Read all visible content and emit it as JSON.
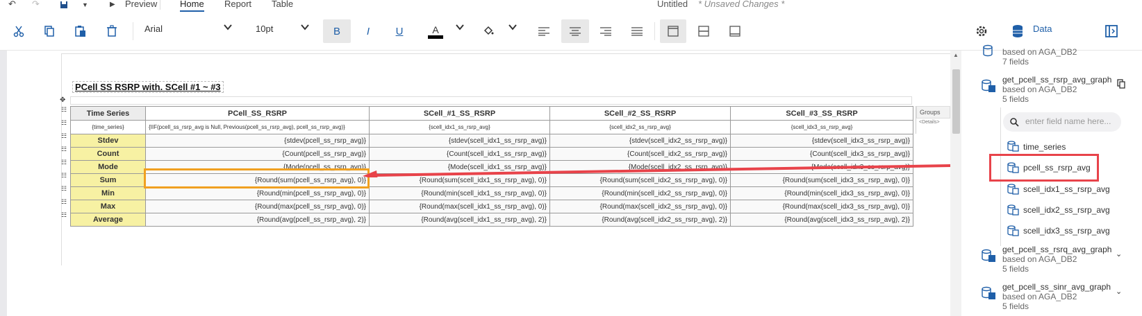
{
  "topbar": {
    "undo": "↶",
    "redo": "↷",
    "preview": "Preview",
    "tabs": [
      "Home",
      "Report",
      "Table"
    ],
    "title": "Untitled",
    "unsaved": "* Unsaved Changes *"
  },
  "toolbar": {
    "font": "Arial",
    "size": "10pt",
    "bold": "B",
    "italic": "I",
    "underline": "U",
    "font_color_glyph": "A",
    "data_label": "Data"
  },
  "report": {
    "title": "PCell SS RSRP with. SCell #1 ~ #3",
    "groups_label": "Groups",
    "details_label": "<Details>"
  },
  "table": {
    "headers": [
      "Time Series",
      "PCell_SS_RSRP",
      "SCell_#1_SS_RSRP",
      "SCell_#2_SS_RSRP",
      "SCell_#3_SS_RSRP"
    ],
    "data_row": [
      "{time_series}",
      "{IIF(pcell_ss_rsrp_avg is Null, Previous(pcell_ss_rsrp_avg), pcell_ss_rsrp_avg)}",
      "{scell_idx1_ss_rsrp_avg}",
      "{scell_idx2_ss_rsrp_avg}",
      "{scell_idx3_ss_rsrp_avg}"
    ],
    "rows": [
      {
        "label": "Stdev",
        "cells": [
          "{stdev(pcell_ss_rsrp_avg)}",
          "{stdev(scell_idx1_ss_rsrp_avg)}",
          "{stdev(scell_idx2_ss_rsrp_avg)}",
          "{stdev(scell_idx3_ss_rsrp_avg)}"
        ]
      },
      {
        "label": "Count",
        "cells": [
          "{Count(pcell_ss_rsrp_avg)}",
          "{Count(scell_idx1_ss_rsrp_avg)}",
          "{Count(scell_idx2_ss_rsrp_avg)}",
          "{Count(scell_idx3_ss_rsrp_avg)}"
        ]
      },
      {
        "label": "Mode",
        "cells": [
          "{Mode(pcell_ss_rsrp_avg)}",
          "{Mode(scell_idx1_ss_rsrp_avg)}",
          "{Mode(scell_idx2_ss_rsrp_avg)}",
          "{Mode(scell_idx3_ss_rsrp_avg)}"
        ]
      },
      {
        "label": "Sum",
        "cells": [
          "{Round(sum(pcell_ss_rsrp_avg), 0)}",
          "{Round(sum(scell_idx1_ss_rsrp_avg), 0)}",
          "{Round(sum(scell_idx2_ss_rsrp_avg), 0)}",
          "{Round(sum(scell_idx3_ss_rsrp_avg), 0)}"
        ]
      },
      {
        "label": "Min",
        "cells": [
          "{Round(min(pcell_ss_rsrp_avg), 0)}",
          "{Round(min(scell_idx1_ss_rsrp_avg), 0)}",
          "{Round(min(scell_idx2_ss_rsrp_avg), 0)}",
          "{Round(min(scell_idx3_ss_rsrp_avg), 0)}"
        ]
      },
      {
        "label": "Max",
        "cells": [
          "{Round(max(pcell_ss_rsrp_avg), 0)}",
          "{Round(max(scell_idx1_ss_rsrp_avg), 0)}",
          "{Round(max(scell_idx2_ss_rsrp_avg), 0)}",
          "{Round(max(scell_idx3_ss_rsrp_avg), 0)}"
        ]
      },
      {
        "label": "Average",
        "cells": [
          "{Round(avg(pcell_ss_rsrp_avg), 2)}",
          "{Round(avg(scell_idx1_ss_rsrp_avg), 2)}",
          "{Round(avg(scell_idx2_ss_rsrp_avg), 2)}",
          "{Round(avg(scell_idx3_ss_rsrp_avg), 2)}"
        ]
      }
    ]
  },
  "side": {
    "top": {
      "based": "based on AGA_DB2",
      "fields": "7 fields"
    },
    "ds1": {
      "name": "get_pcell_ss_rsrp_avg_graph",
      "based": "based on AGA_DB2",
      "fields": "5 fields"
    },
    "search_placeholder": "enter field name here...",
    "fields": [
      "time_series",
      "pcell_ss_rsrp_avg",
      "scell_idx1_ss_rsrp_avg",
      "scell_idx2_ss_rsrp_avg",
      "scell_idx3_ss_rsrp_avg"
    ],
    "ds2": {
      "name": "get_pcell_ss_rsrq_avg_graph",
      "based": "based on AGA_DB2",
      "fields": "5 fields"
    },
    "ds3": {
      "name": "get_pcell_ss_sinr_avg_graph",
      "based": "based on AGA_DB2",
      "fields": "5 fields"
    }
  },
  "colors": {
    "highlight_orange": "#f0a020",
    "highlight_red": "#e8434a",
    "label_yellow": "#f7f1a3",
    "table_border": "#2c4a6a"
  }
}
